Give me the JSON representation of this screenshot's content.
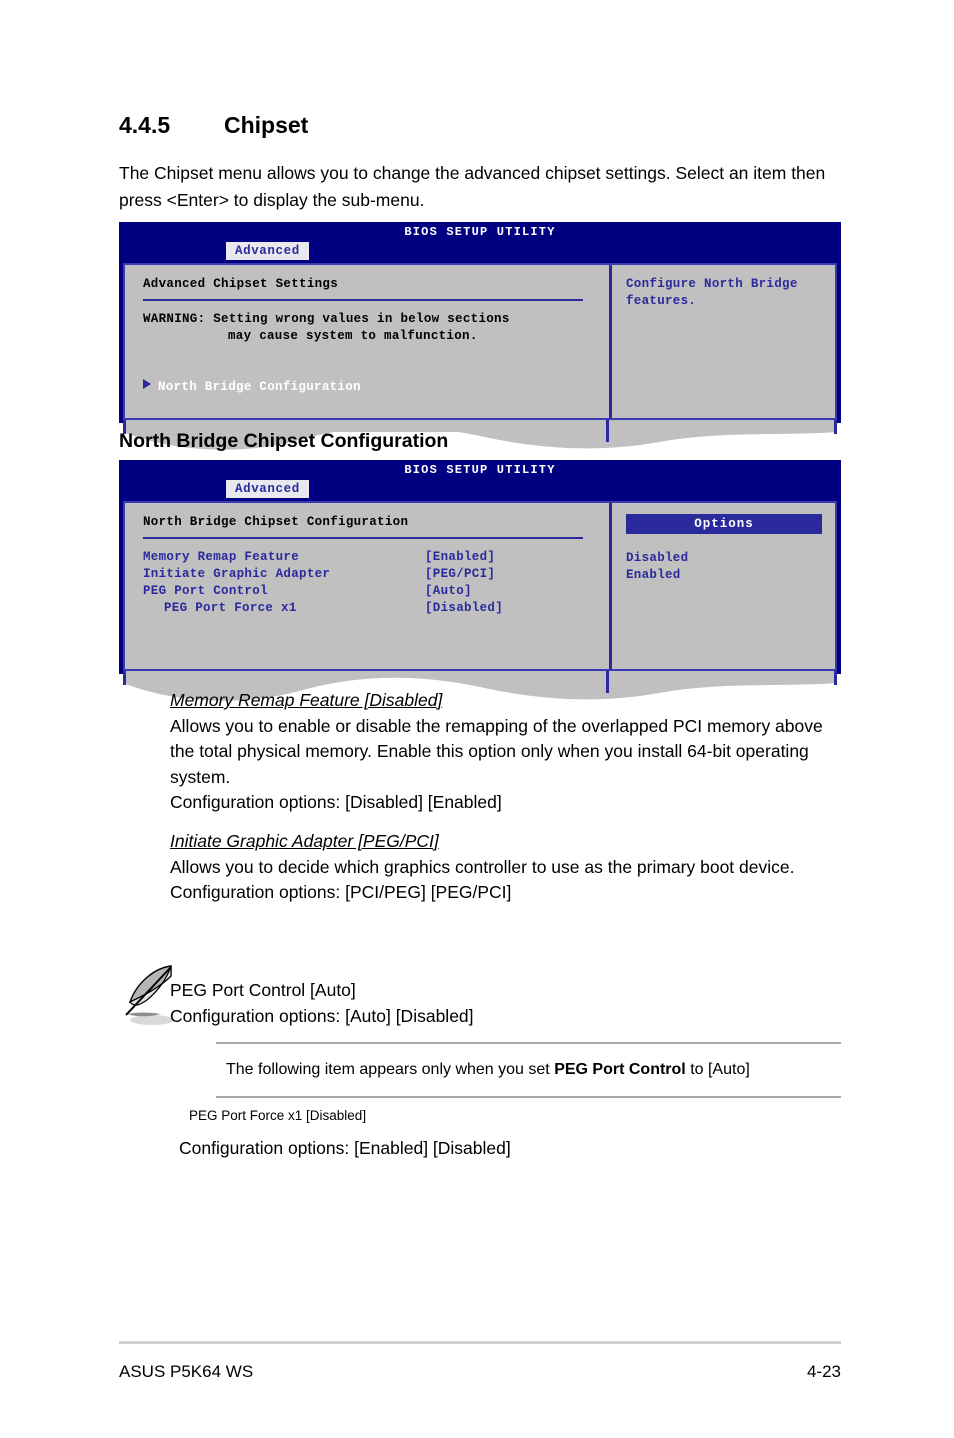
{
  "section": {
    "number": "4.4.5",
    "title": "Chipset",
    "intro": "The Chipset menu allows you to change the advanced chipset settings. Select an item then press <Enter> to display the sub-menu."
  },
  "bios_screen_1": {
    "title": "BIOS SETUP UTILITY",
    "tab": "Advanced",
    "heading": "Advanced Chipset Settings",
    "warning_line1": "WARNING: Setting wrong values in below sections",
    "warning_line2": "may cause system to malfunction.",
    "menu_item": "North Bridge Configuration",
    "help_text": "Configure North Bridge features."
  },
  "subsection_title": "North Bridge Chipset Configuration",
  "bios_screen_2": {
    "title": "BIOS SETUP UTILITY",
    "tab": "Advanced",
    "heading": "North Bridge Chipset Configuration",
    "options_label": "Options",
    "options": [
      "Disabled",
      "Enabled"
    ],
    "items": [
      {
        "label": "Memory Remap Feature",
        "value": "[Enabled]",
        "indent": false
      },
      {
        "label": "Initiate Graphic Adapter",
        "value": "[PEG/PCI]",
        "indent": false
      },
      {
        "label": "PEG Port Control",
        "value": "[Auto]",
        "indent": false
      },
      {
        "label": "PEG Port Force x1",
        "value": "[Disabled]",
        "indent": true
      }
    ]
  },
  "descriptions": [
    {
      "title": "Memory Remap Feature [Disabled]",
      "body": "Allows you to enable or disable the remapping of the overlapped PCI memory above the total physical memory. Enable this option only when you install 64-bit operating system.",
      "config": "Configuration options: [Disabled] [Enabled]"
    },
    {
      "title": "Initiate Graphic Adapter [PEG/PCI]",
      "body": "Allows you to decide which graphics controller to use as the primary boot device.",
      "config": "Configuration options: [PCI/PEG] [PEG/PCI]"
    }
  ],
  "note": {
    "title": "PEG Port Control [Auto]",
    "config": "Configuration options: [Auto] [Disabled]",
    "icon": "quill-pen-icon"
  },
  "callout": {
    "prefix": "The following item appears only when you set ",
    "bold": "PEG Port Control",
    "suffix": " to [Auto]"
  },
  "last_item": {
    "title": "PEG Port Force x1 [Disabled]",
    "config": "Configuration options: [Enabled] [Disabled]"
  },
  "footer": {
    "left": "ASUS P5K64 WS",
    "right": "4-23"
  },
  "colors": {
    "bios_header": "#000080",
    "bios_panel": "#c0c0c0",
    "bios_blue_text": "#2a2a9c",
    "options_bar": "#2a2a9c",
    "rule_gray": "#a8a8a8"
  }
}
